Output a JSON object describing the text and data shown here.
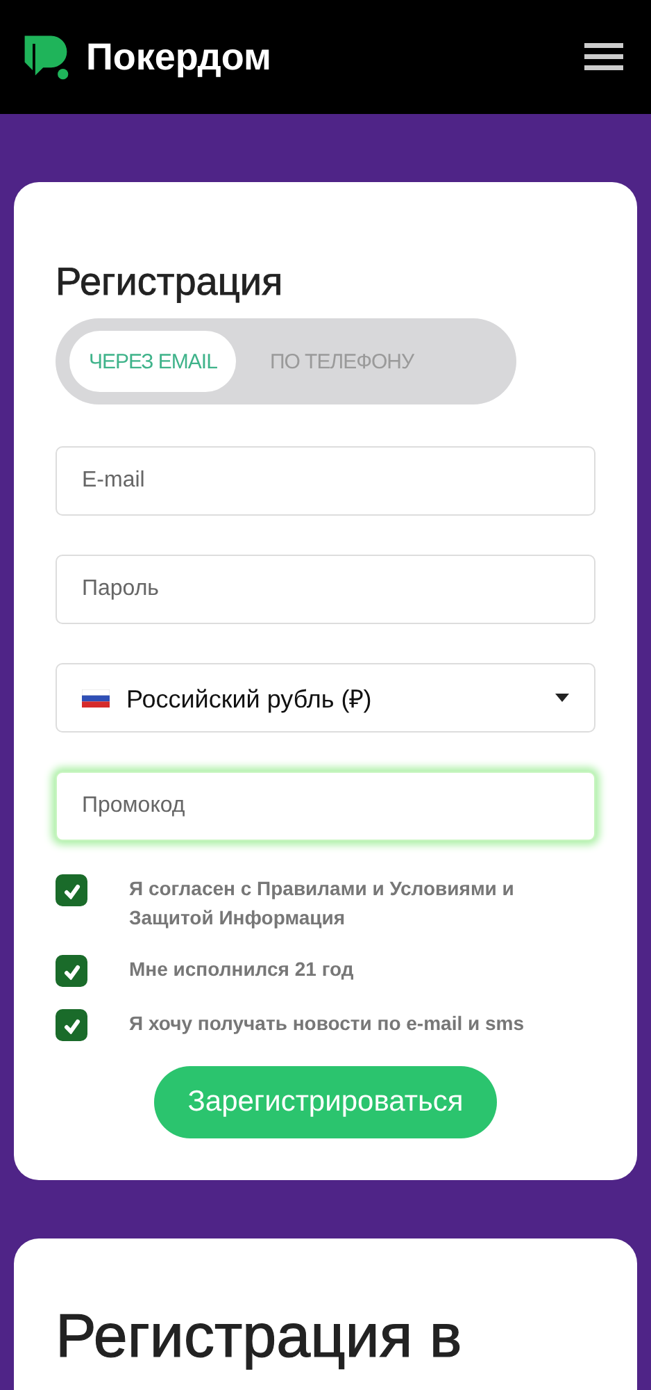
{
  "header": {
    "logo_text": "Покердом"
  },
  "form": {
    "title": "Регистрация",
    "tabs": [
      {
        "label": "ЧЕРЕЗ EMAIL",
        "selected": true
      },
      {
        "label": "ПО ТЕЛЕФОНУ",
        "selected": false
      }
    ],
    "fields": [
      {
        "kind": "text",
        "placeholder": "E-mail",
        "focused": false
      },
      {
        "kind": "password",
        "placeholder": "Пароль",
        "focused": false
      },
      {
        "kind": "select",
        "value": "Российский рубль (₽)",
        "focused": false
      },
      {
        "kind": "text",
        "placeholder": "Промокод",
        "focused": true
      }
    ],
    "checkboxes": [
      {
        "label": "Я согласен с Правилами и Условиями и Защитой Информация",
        "checked": true
      },
      {
        "label": "Мне исполнился 21 год",
        "checked": true
      },
      {
        "label": "Я хочу получать новости по e-mail и sms",
        "checked": true
      }
    ],
    "submit": "Зарегистрироваться"
  },
  "section": {
    "title": "Регистрация в"
  }
}
